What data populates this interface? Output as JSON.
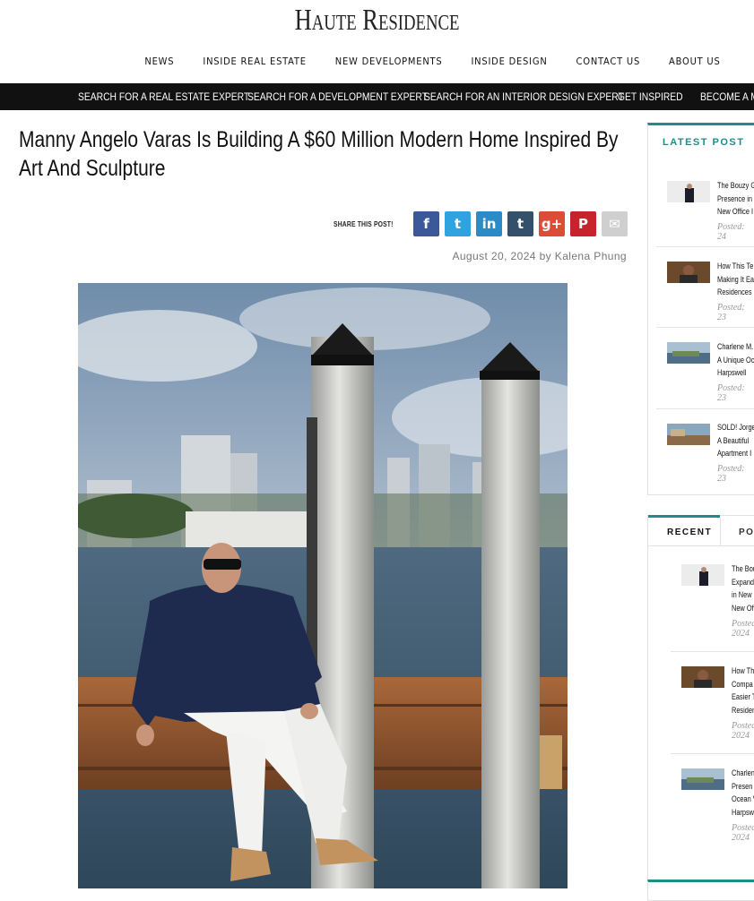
{
  "site": {
    "logo": "Haute Residence"
  },
  "top_nav": [
    "NEWS",
    "INSIDE REAL ESTATE",
    "NEW DEVELOPMENTS",
    "INSIDE DESIGN",
    "CONTACT US",
    "ABOUT US"
  ],
  "black_nav": [
    "SEARCH FOR A REAL ESTATE EXPERT",
    "SEARCH FOR A DEVELOPMENT EXPERT",
    "SEARCH FOR AN INTERIOR DESIGN EXPERT",
    "GET INSPIRED",
    "BECOME A ME"
  ],
  "article": {
    "title": "Manny Angelo Varas Is Building A $60 Million Modern Home Inspired By Art And Sculpture",
    "share_label": "SHARE THIS POST!",
    "date": "August 20, 2024",
    "by": "by",
    "author": "Kalena Phung"
  },
  "social": [
    {
      "name": "facebook-icon",
      "glyph": "f",
      "color": "#3b5998"
    },
    {
      "name": "twitter-icon",
      "glyph": "t",
      "color": "#2fa3df"
    },
    {
      "name": "linkedin-icon",
      "glyph": "in",
      "color": "#2a8bc6"
    },
    {
      "name": "tumblr-icon",
      "glyph": "t",
      "color": "#34506b"
    },
    {
      "name": "googleplus-icon",
      "glyph": "g+",
      "color": "#dd4b39"
    },
    {
      "name": "pinterest-icon",
      "glyph": "P",
      "color": "#c8232c"
    },
    {
      "name": "email-icon",
      "glyph": "✉",
      "color": "#cfcfcf"
    }
  ],
  "sidebar": {
    "latest_title": "LATEST POST",
    "latest": [
      {
        "lines": [
          "The Bouzy G",
          "Presence in",
          "New Office I"
        ],
        "posted": "Posted: 24"
      },
      {
        "lines": [
          "How This Te",
          "Making It Ea",
          "Residences"
        ],
        "posted": "Posted: 23"
      },
      {
        "lines": [
          "Charlene M.",
          "A Unique Oc",
          "Harpswell"
        ],
        "posted": "Posted: 23"
      },
      {
        "lines": [
          "SOLD! Jorge",
          "A Beautiful",
          "Apartment I"
        ],
        "posted": "Posted: 23"
      }
    ],
    "tabs": [
      "RECENT",
      "POP"
    ],
    "recent": [
      {
        "lines": [
          "The Bou",
          "Expands",
          "in New",
          "New Off"
        ],
        "posted": "Posted",
        "year": "2024"
      },
      {
        "lines": [
          "How Th",
          "Compa",
          "Easier T",
          "Residen"
        ],
        "posted": "Posted",
        "year": "2024"
      },
      {
        "lines": [
          "Charlen",
          "Presen",
          "Ocean V",
          "Harpsw"
        ],
        "posted": "Posted",
        "year": "2024"
      }
    ]
  },
  "colors": {
    "accent": "#1e8c8c",
    "bar": "#111111"
  }
}
